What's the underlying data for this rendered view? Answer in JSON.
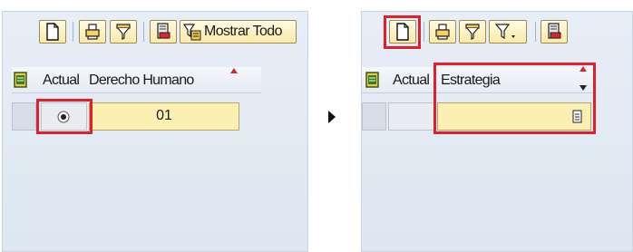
{
  "left_table": {
    "toolbar": {
      "show_all_label": "Mostrar Todo"
    },
    "columns": {
      "actual": "Actual",
      "derecho_humano": "Derecho Humano"
    },
    "row": {
      "value": "01"
    }
  },
  "right_table": {
    "columns": {
      "actual": "Actual",
      "estrategia": "Estrategia"
    },
    "row": {
      "value": ""
    }
  },
  "icons": {
    "new": "new-document-icon",
    "print": "print-icon",
    "filter": "filter-icon",
    "filter_dropdown": "filter-dropdown-icon",
    "export": "export-icon",
    "show_all": "show-all-icon",
    "select": "column-select-icon",
    "arrow": "arrow-right-icon",
    "f4": "value-help-icon",
    "radio": "radio-icon"
  },
  "colors": {
    "highlight": "#e0202a",
    "cell": "#fcefb2",
    "panel": "#dde6f1"
  }
}
